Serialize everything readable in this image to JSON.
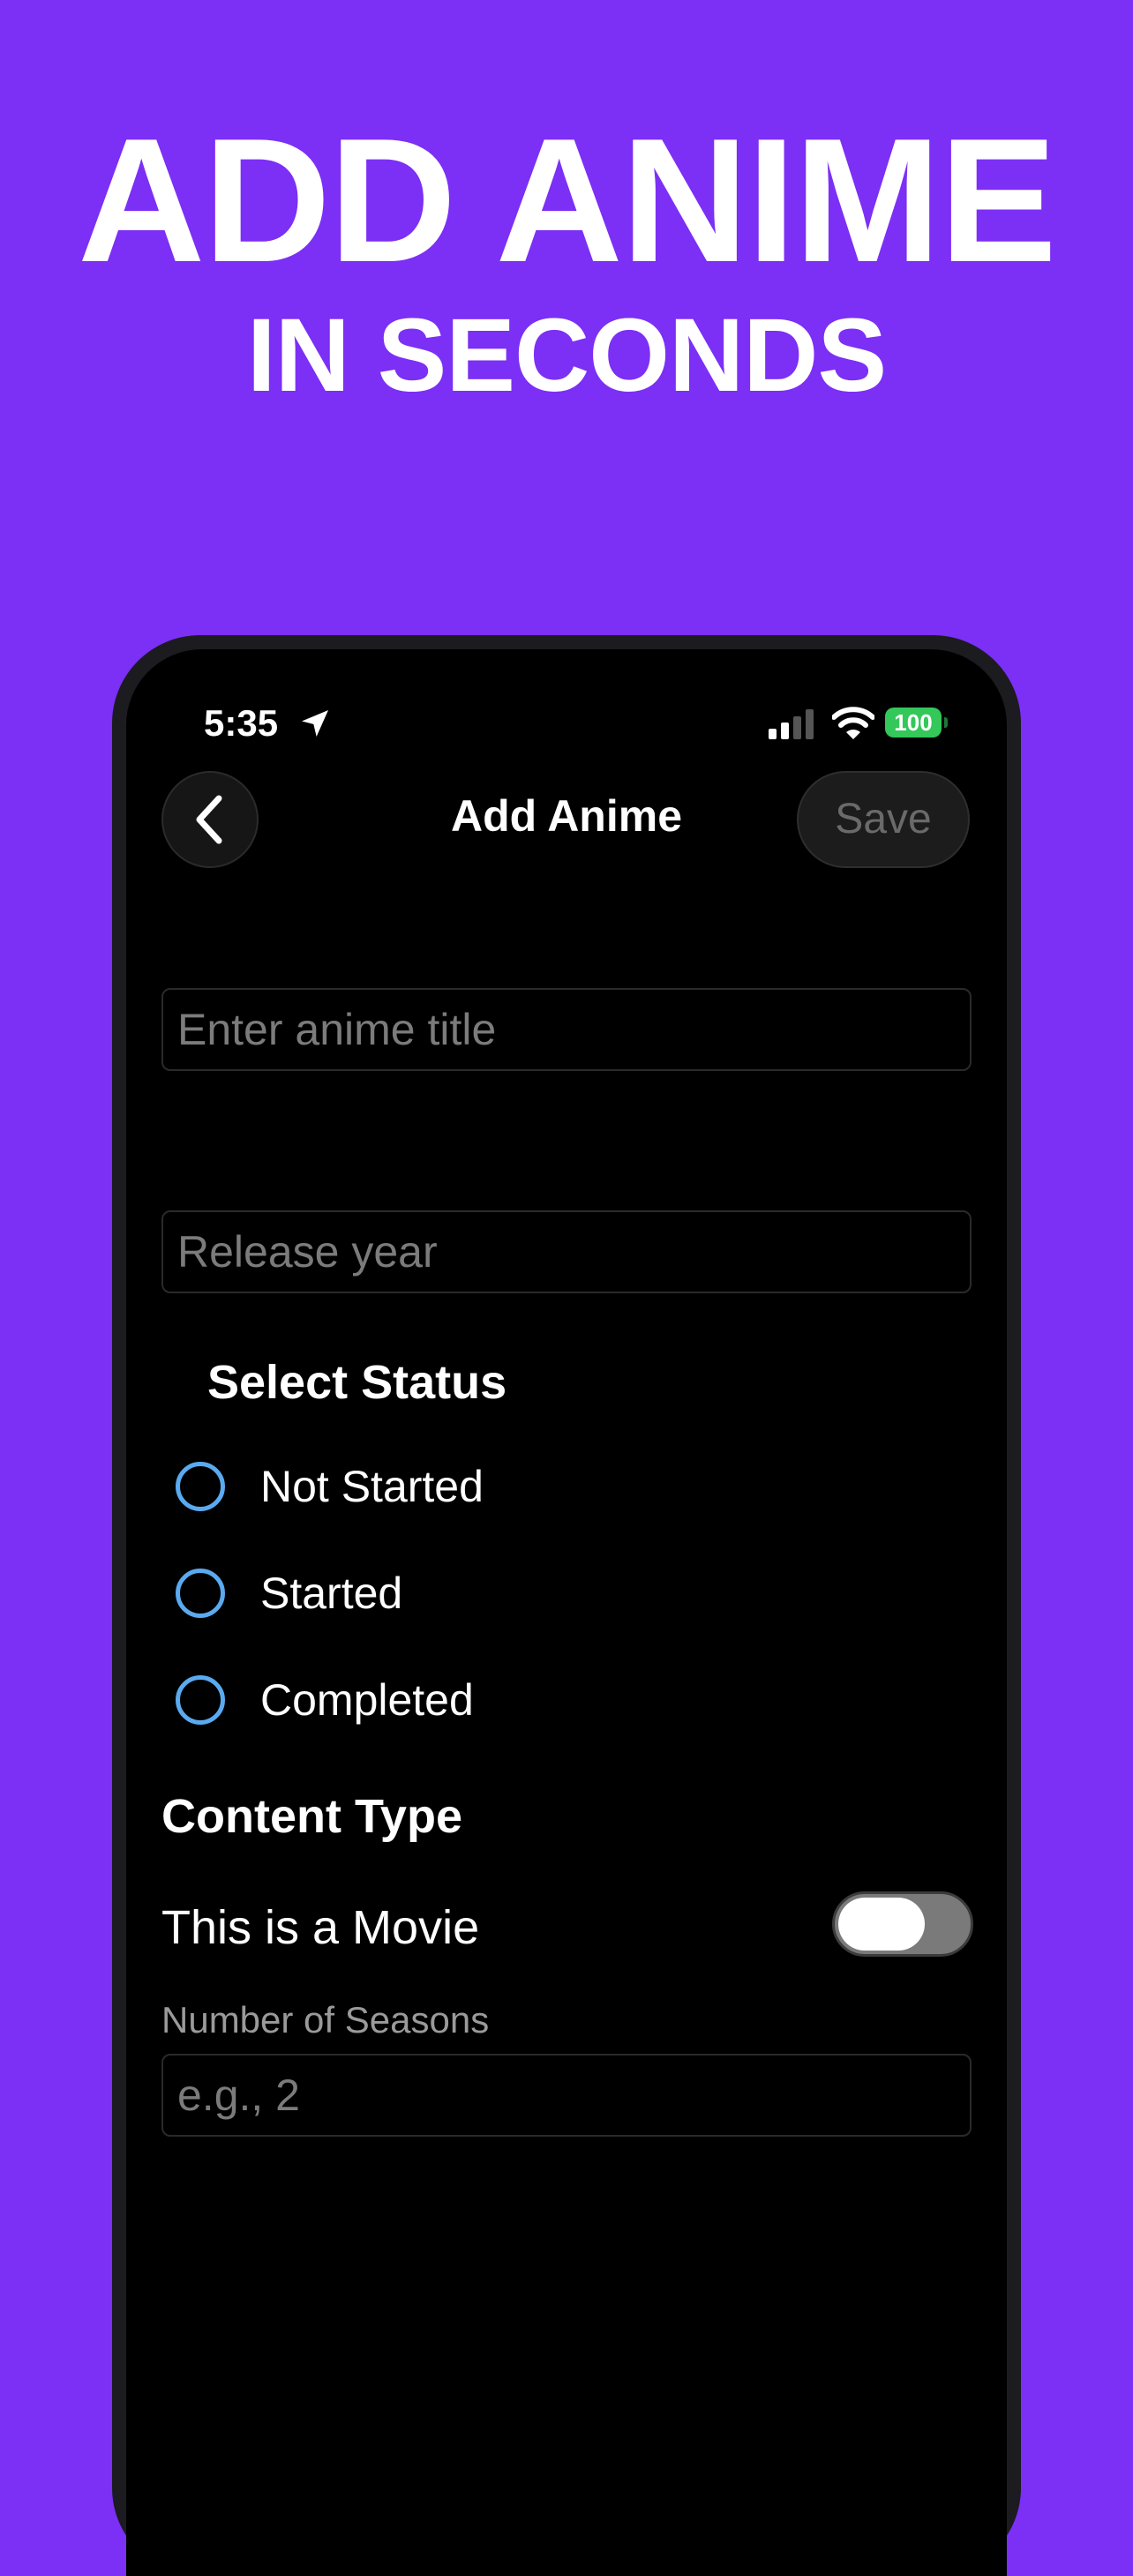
{
  "promo": {
    "headline_line1": "ADD ANIME",
    "headline_line2": "IN SECONDS"
  },
  "status_bar": {
    "time": "5:35",
    "battery": "100"
  },
  "nav": {
    "title": "Add Anime",
    "save_label": "Save"
  },
  "form": {
    "title_placeholder": "Enter anime title",
    "year_placeholder": "Release year",
    "status_section_title": "Select Status",
    "status_options": [
      {
        "label": "Not Started"
      },
      {
        "label": "Started"
      },
      {
        "label": "Completed"
      }
    ],
    "content_type_title": "Content Type",
    "movie_toggle_label": "This is a Movie",
    "movie_toggle_on": false,
    "seasons_label": "Number of Seasons",
    "seasons_placeholder": "e.g., 2"
  },
  "colors": {
    "background": "#7c2ff5",
    "radio_accent": "#5aaaf0",
    "battery": "#34c759"
  }
}
